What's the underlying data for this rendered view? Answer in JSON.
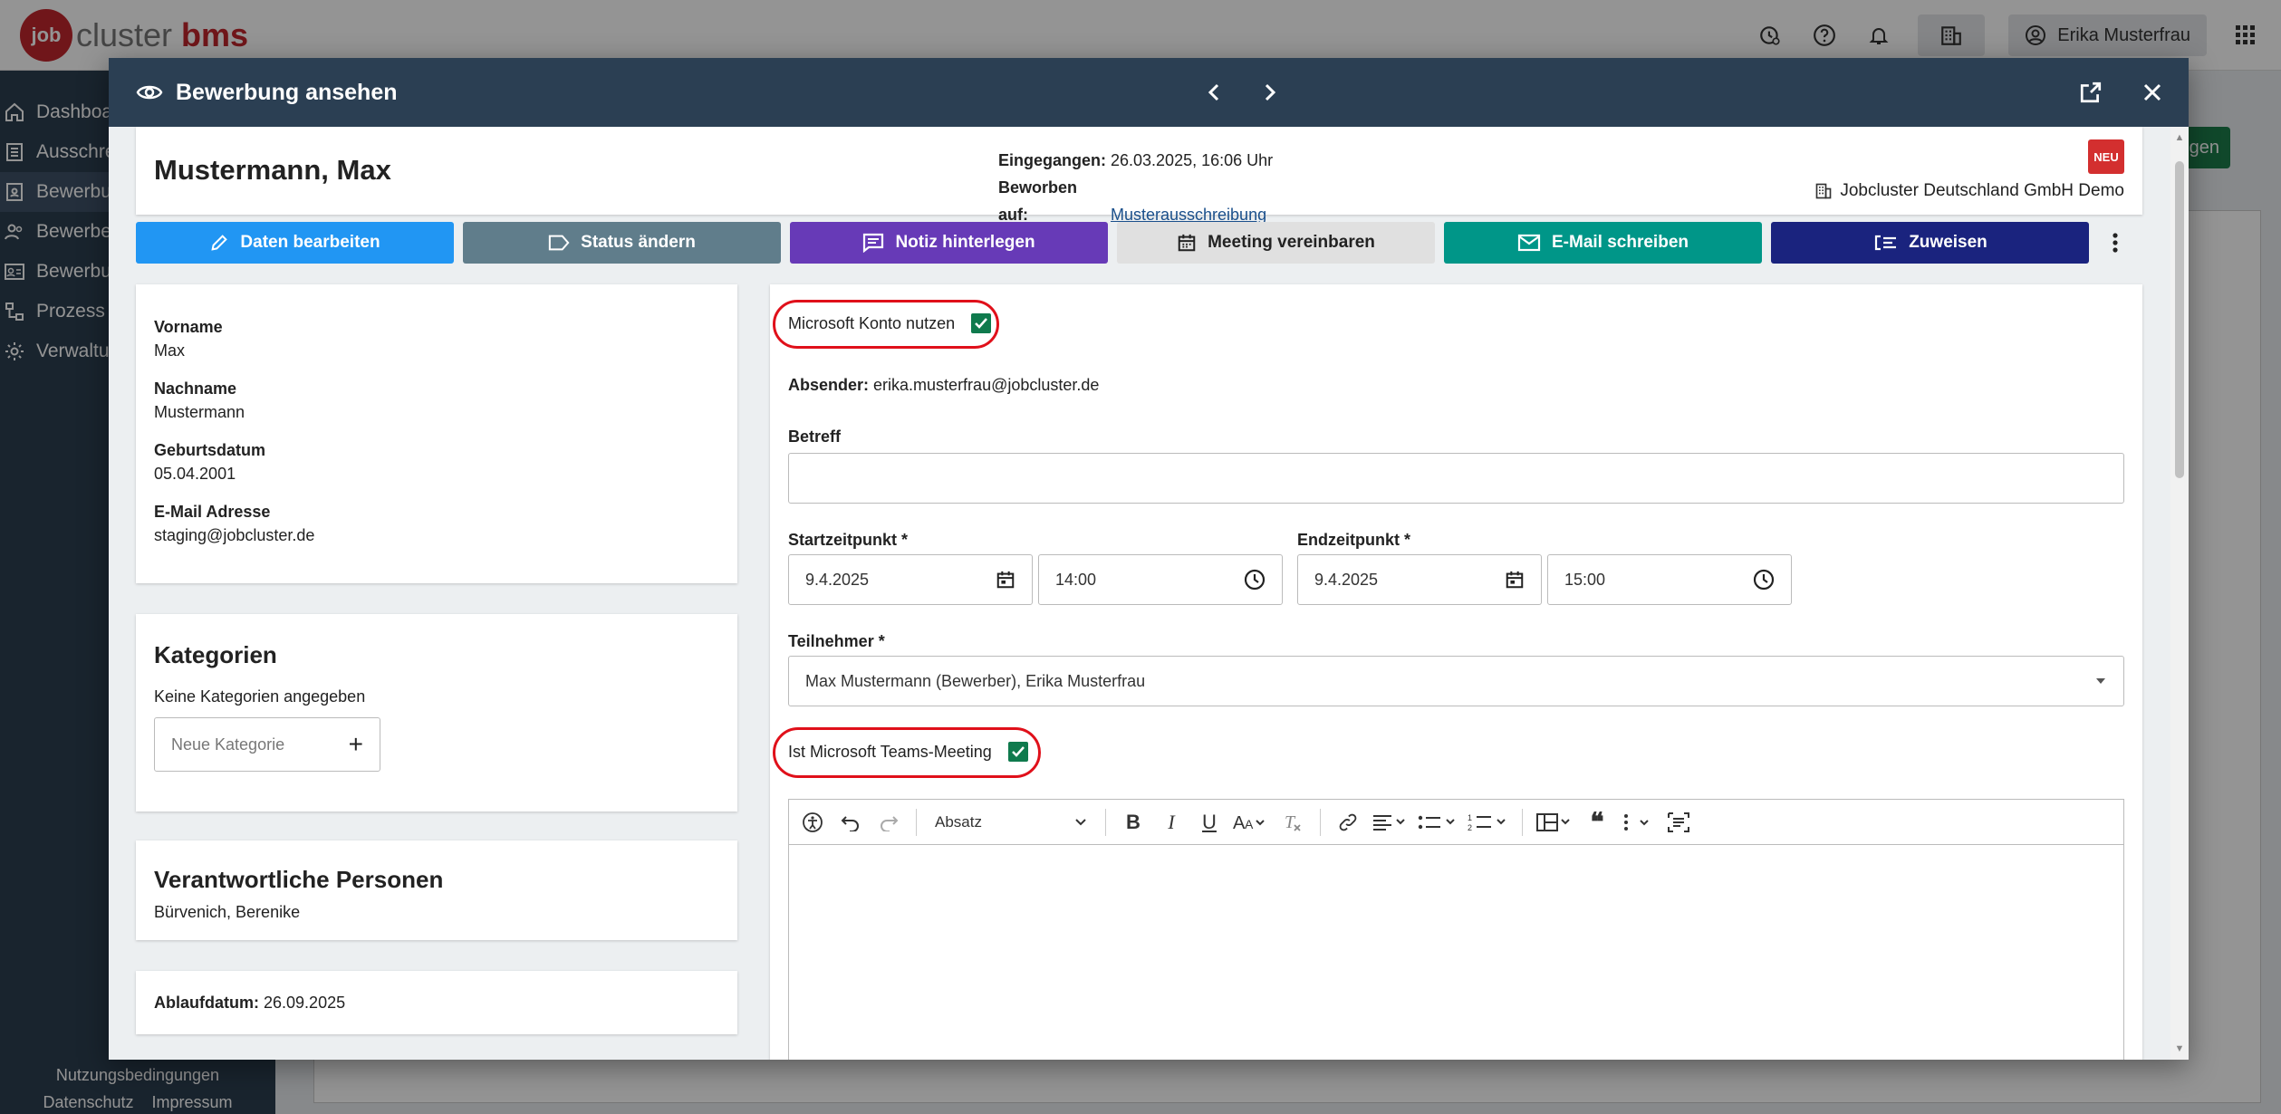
{
  "app": {
    "logo": {
      "mark": "job",
      "text_job": "job",
      "text_cluster": "cluster",
      "text_bms": " bms"
    },
    "user_name": "Erika Musterfrau",
    "top_icons": [
      "time-settings-icon",
      "help-icon",
      "bell-icon",
      "building-icon",
      "user-icon",
      "apps-grid-icon"
    ]
  },
  "sidebar": {
    "items": [
      {
        "label": "Dashboa",
        "icon": "home-icon"
      },
      {
        "label": "Ausschre",
        "icon": "list-icon"
      },
      {
        "label": "Bewerbu",
        "icon": "applicant-icon"
      },
      {
        "label": "Bewerbe",
        "icon": "people-icon"
      },
      {
        "label": "Bewerbu",
        "icon": "id-card-icon"
      },
      {
        "label": "Prozess",
        "icon": "process-icon"
      },
      {
        "label": "Verwaltu",
        "icon": "gear-icon"
      }
    ],
    "footer": {
      "terms": "Nutzungsbedingungen",
      "privacy": "Datenschutz",
      "imprint": "Impressum"
    }
  },
  "background": {
    "green_button_fragment": "gen"
  },
  "modal": {
    "title": "Bewerbung ansehen",
    "applicant": {
      "name": "Mustermann, Max",
      "received_label": "Eingegangen:",
      "received_value": "26.03.2025, 16:06 Uhr",
      "applied_label": "Beworben auf:",
      "applied_value": "Musterausschreibung",
      "badge": "NEU",
      "company": "Jobcluster Deutschland GmbH Demo"
    },
    "actions": {
      "edit": "Daten bearbeiten",
      "status": "Status ändern",
      "note": "Notiz hinterlegen",
      "meeting": "Meeting vereinbaren",
      "email": "E-Mail schreiben",
      "assign": "Zuweisen"
    },
    "info": {
      "first_name_label": "Vorname",
      "first_name": "Max",
      "last_name_label": "Nachname",
      "last_name": "Mustermann",
      "birthdate_label": "Geburtsdatum",
      "birthdate": "05.04.2001",
      "email_label": "E-Mail Adresse",
      "email": "staging@jobcluster.de"
    },
    "categories": {
      "title": "Kategorien",
      "empty": "Keine Kategorien angegeben",
      "placeholder": "Neue Kategorie",
      "add": "+"
    },
    "responsible": {
      "title": "Verantwortliche Personen",
      "value": "Bürvenich, Berenike"
    },
    "expiry": {
      "label": "Ablaufdatum:",
      "value": "26.09.2025"
    },
    "meeting_form": {
      "ms_account_label": "Microsoft Konto nutzen",
      "ms_account_checked": true,
      "sender_label": "Absender:",
      "sender_value": "erika.musterfrau@jobcluster.de",
      "subject_label": "Betreff",
      "subject_value": "",
      "start_label": "Startzeitpunkt *",
      "start_date": "9.4.2025",
      "start_time": "14:00",
      "end_label": "Endzeitpunkt *",
      "end_date": "9.4.2025",
      "end_time": "15:00",
      "participants_label": "Teilnehmer *",
      "participants_value": "Max Mustermann (Bewerber), Erika Musterfrau",
      "teams_label": "Ist Microsoft Teams-Meeting",
      "teams_checked": true,
      "editor_paragraph": "Absatz"
    }
  },
  "colors": {
    "header": "#2b3f53",
    "sidebar": "#2c3e50",
    "edit_btn": "#2196f3",
    "status_btn": "#607d8b",
    "note_btn": "#673ab7",
    "meeting_btn": "#e0e0e0",
    "email_btn": "#009688",
    "assign_btn": "#1a237e",
    "badge": "#d32f2f",
    "checkbox": "#0f7a4d",
    "highlight_ring": "#e0101a"
  }
}
